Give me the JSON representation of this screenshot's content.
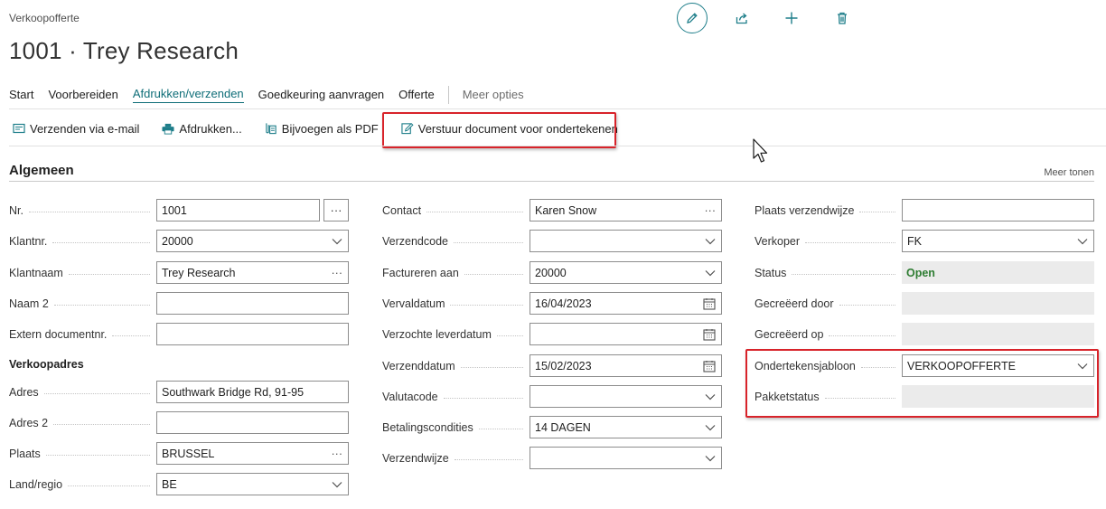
{
  "page": {
    "breadcrumb": "Verkoopofferte",
    "title": "1001 · Trey Research"
  },
  "top_actions": {
    "edit_icon": "pencil-icon",
    "share_icon": "share-icon",
    "new_icon": "plus-icon",
    "delete_icon": "trash-icon"
  },
  "tabs": [
    {
      "label": "Start",
      "active": false
    },
    {
      "label": "Voorbereiden",
      "active": false
    },
    {
      "label": "Afdrukken/verzenden",
      "active": true
    },
    {
      "label": "Goedkeuring aanvragen",
      "active": false
    },
    {
      "label": "Offerte",
      "active": false
    },
    {
      "label": "Meer opties",
      "active": false
    }
  ],
  "actions": [
    {
      "label": "Verzenden via e-mail",
      "icon": "email-icon"
    },
    {
      "label": "Afdrukken...",
      "icon": "printer-icon"
    },
    {
      "label": "Bijvoegen als PDF",
      "icon": "attach-pdf-icon"
    },
    {
      "label": "Verstuur document voor ondertekenen",
      "icon": "sign-document-icon",
      "highlighted": true
    }
  ],
  "section": {
    "title": "Algemeen",
    "show_more": "Meer tonen"
  },
  "col1": {
    "nr_label": "Nr.",
    "nr_value": "1001",
    "klantnr_label": "Klantnr.",
    "klantnr_value": "20000",
    "klantnaam_label": "Klantnaam",
    "klantnaam_value": "Trey Research",
    "naam2_label": "Naam 2",
    "naam2_value": "",
    "extern_label": "Extern documentnr.",
    "extern_value": "",
    "verkoopadres_heading": "Verkoopadres",
    "adres_label": "Adres",
    "adres_value": "Southwark Bridge Rd, 91-95",
    "adres2_label": "Adres 2",
    "adres2_value": "",
    "plaats_label": "Plaats",
    "plaats_value": "BRUSSEL",
    "land_label": "Land/regio",
    "land_value": "BE"
  },
  "col2": {
    "contact_label": "Contact",
    "contact_value": "Karen Snow",
    "verzendcode_label": "Verzendcode",
    "verzendcode_value": "",
    "factureren_label": "Factureren aan",
    "factureren_value": "20000",
    "vervaldatum_label": "Vervaldatum",
    "vervaldatum_value": "16/04/2023",
    "leverdatum_label": "Verzochte leverdatum",
    "leverdatum_value": "",
    "verzenddatum_label": "Verzenddatum",
    "verzenddatum_value": "15/02/2023",
    "valutacode_label": "Valutacode",
    "valutacode_value": "",
    "betaling_label": "Betalingscondities",
    "betaling_value": "14 DAGEN",
    "verzendwijze_label": "Verzendwijze",
    "verzendwijze_value": ""
  },
  "col3": {
    "plaats_verzend_label": "Plaats verzendwijze",
    "plaats_verzend_value": "",
    "verkoper_label": "Verkoper",
    "verkoper_value": "FK",
    "status_label": "Status",
    "status_value": "Open",
    "gecreeerd_door_label": "Gecreëerd door",
    "gecreeerd_door_value": "",
    "gecreeerd_op_label": "Gecreëerd op",
    "gecreeerd_op_value": "",
    "sjabloon_label": "Ondertekensjabloon",
    "sjabloon_value": "VERKOOPOFFERTE",
    "pakket_label": "Pakketstatus",
    "pakket_value": ""
  },
  "colors": {
    "accent": "#0f6e78",
    "highlight": "#d8232a",
    "status_open": "#2e7d32"
  }
}
